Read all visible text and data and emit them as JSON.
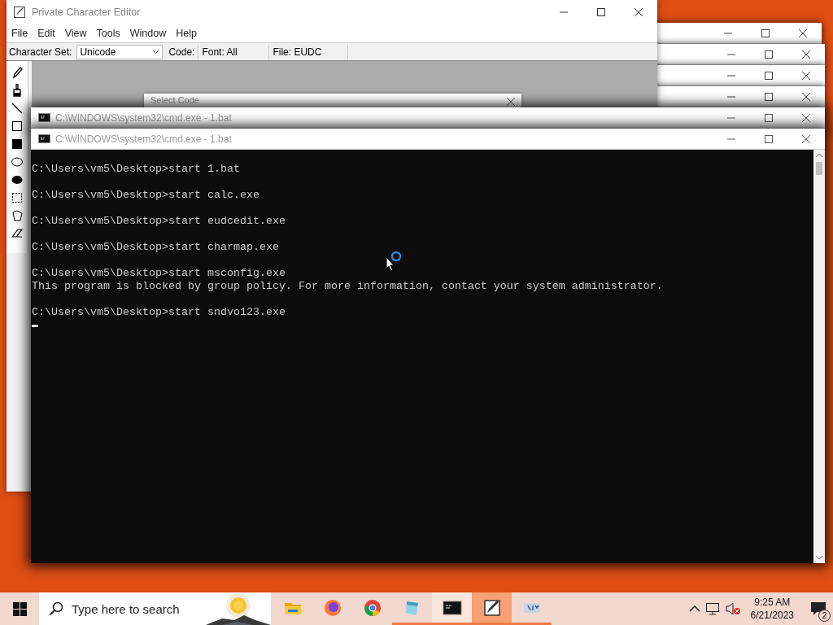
{
  "editor": {
    "title": "Private Character Editor",
    "menu": [
      "File",
      "Edit",
      "View",
      "Tools",
      "Window",
      "Help"
    ],
    "toolbar": {
      "charset_label": "Character Set:",
      "charset_value": "Unicode",
      "code_label": "Code:",
      "font_label": "Font: All",
      "file_label": "File: EUDC"
    },
    "tools": [
      {
        "kind": "pencil"
      },
      {
        "kind": "brush"
      },
      {
        "kind": "line"
      },
      {
        "kind": "rect"
      },
      {
        "kind": "filled-rect"
      },
      {
        "kind": "ellipse"
      },
      {
        "kind": "filled-ellipse"
      },
      {
        "kind": "rect-select"
      },
      {
        "kind": "free-select"
      },
      {
        "kind": "eraser"
      }
    ],
    "dialog": {
      "title": "Select Code"
    }
  },
  "background_windows": [
    {
      "kind": "blank"
    },
    {
      "kind": "blank"
    },
    {
      "kind": "blank"
    },
    {
      "kind": "blank"
    }
  ],
  "consoles": [
    {
      "title": "C:\\WINDOWS\\system32\\cmd.exe - 1.bat"
    },
    {
      "title": "C:\\WINDOWS\\system32\\cmd.exe - 1.bat",
      "lines": [
        {
          "kind": "command",
          "text": "C:\\Users\\vm5\\Desktop>start 1.bat"
        },
        {
          "kind": "command",
          "text": "C:\\Users\\vm5\\Desktop>start calc.exe"
        },
        {
          "kind": "command",
          "text": "C:\\Users\\vm5\\Desktop>start eudcedit.exe"
        },
        {
          "kind": "command",
          "text": "C:\\Users\\vm5\\Desktop>start charmap.exe"
        },
        {
          "kind": "command",
          "text": "C:\\Users\\vm5\\Desktop>start msconfig.exe"
        },
        {
          "kind": "message",
          "text": "This program is blocked by group policy. For more information, contact your system administrator."
        },
        {
          "kind": "command",
          "text": "C:\\Users\\vm5\\Desktop>start sndvo123.exe"
        }
      ]
    }
  ],
  "taskbar": {
    "search_placeholder": "Type here to search",
    "apps": [
      {
        "kind": "folder",
        "running": false,
        "selected": false,
        "flashing": false
      },
      {
        "kind": "firefox",
        "running": false,
        "selected": false,
        "flashing": false
      },
      {
        "kind": "chrome",
        "running": false,
        "selected": false,
        "flashing": false
      },
      {
        "kind": "notepad",
        "running": true,
        "selected": false,
        "flashing": false
      },
      {
        "kind": "console",
        "running": true,
        "selected": true,
        "flashing": false
      },
      {
        "kind": "editor",
        "running": true,
        "selected": false,
        "flashing": true
      },
      {
        "kind": "charmap",
        "running": true,
        "selected": false,
        "flashing": false
      }
    ],
    "time": "9:25 AM",
    "date": "6/21/2023",
    "notifications": "2"
  }
}
